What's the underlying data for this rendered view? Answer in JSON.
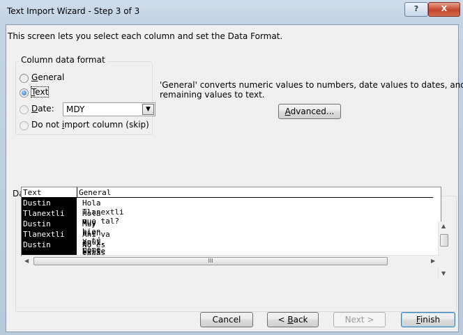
{
  "window": {
    "title": "Text Import Wizard - Step 3 of 3",
    "help_glyph": "?",
    "close_glyph": "X"
  },
  "intro_text": "This screen lets you select each column and set the Data Format.",
  "column_format": {
    "legend": "Column data format",
    "options": {
      "general": {
        "access": "G",
        "rest": "eneral",
        "selected": false
      },
      "text": {
        "access": "T",
        "rest": "ext",
        "selected": true
      },
      "date": {
        "access": "D",
        "rest": "ate:",
        "selected": false
      },
      "skip": {
        "pre": "Do not ",
        "access": "i",
        "rest": "mport column (skip)",
        "selected": false
      }
    },
    "date_format_value": "MDY"
  },
  "description": {
    "line1": "'General' converts numeric values to numbers, date values to dates, and all",
    "line2": "remaining values to text."
  },
  "advanced_button": {
    "access": "A",
    "rest": "dvanced..."
  },
  "preview": {
    "legend_pre": "Data ",
    "legend_access": "p",
    "legend_rest": "review",
    "headers": [
      "Text",
      "General"
    ],
    "rows": [
      [
        "Dustin",
        "Hola Tlanextli que tal?"
      ],
      [
        "Tlanextli",
        "Hola Muy bien y tú cómo estás"
      ],
      [
        "Dustin",
        "Muy bien aquí. No te veo hoy nada más tengo tu foto ahí. O ahí e"
      ],
      [
        "Tlanextli",
        "Ahí va eh estás en el parque verdad."
      ],
      [
        "Dustin",
        "No es todo y atrás de mi casa."
      ]
    ],
    "hscroll_grip": "III"
  },
  "buttons": {
    "cancel": "Cancel",
    "back_pre": "< ",
    "back_access": "B",
    "back_rest": "ack",
    "next": "Next >",
    "finish_access": "F",
    "finish_rest": "inish"
  }
}
